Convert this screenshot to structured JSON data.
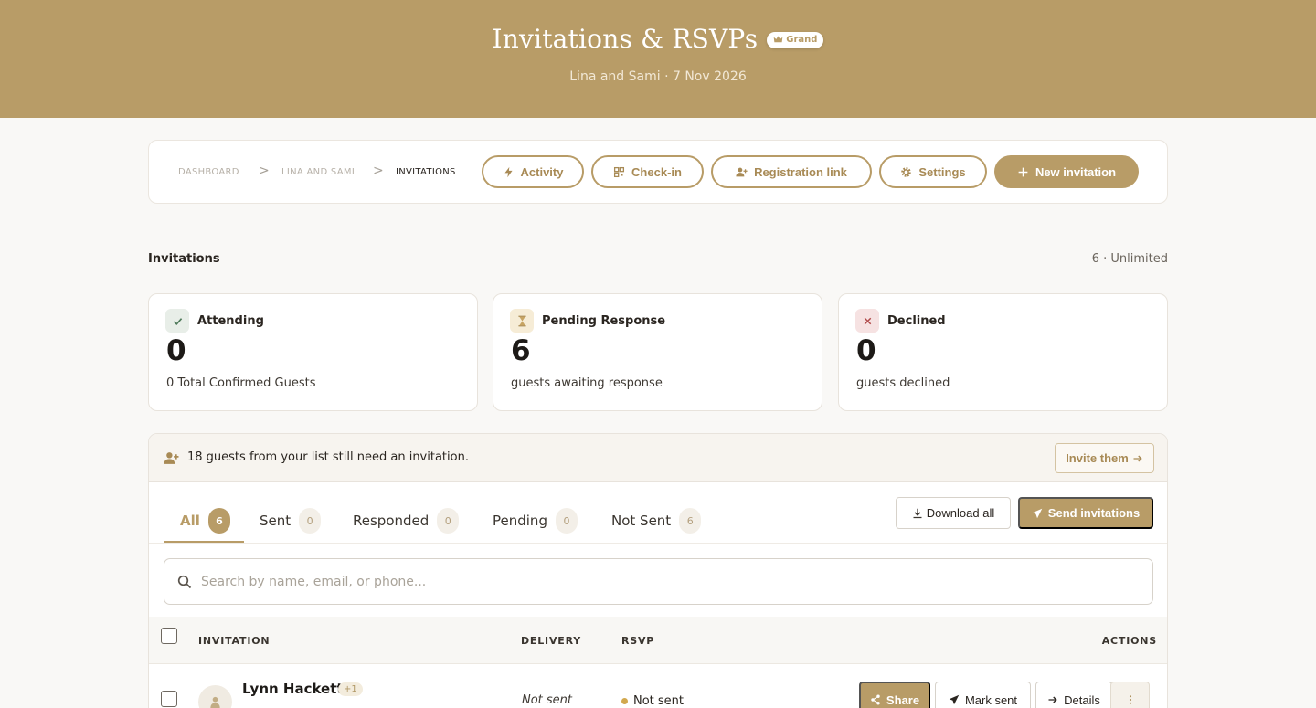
{
  "header": {
    "title": "Invitations & RSVPs",
    "tier": "Grand",
    "subtitle": "Lina and Sami · 7 Nov 2026"
  },
  "breadcrumb": {
    "items": [
      "DASHBOARD",
      "LINA AND SAMI",
      "INVITATIONS"
    ],
    "separator": ">"
  },
  "toolbar": {
    "activity": "Activity",
    "checkin": "Check-in",
    "registration_link": "Registration link",
    "settings": "Settings",
    "new_invitation": "New invitation"
  },
  "section": {
    "title": "Invitations",
    "meta": "6 · Unlimited"
  },
  "stats": [
    {
      "label": "Attending",
      "value": "0",
      "desc": "0 Total Confirmed Guests",
      "icon": "check-icon",
      "color": "#e8eee8"
    },
    {
      "label": "Pending Response",
      "value": "6",
      "desc": "guests awaiting response",
      "icon": "hourglass-icon",
      "color": "#f6ecd6"
    },
    {
      "label": "Declined",
      "value": "0",
      "desc": "guests declined",
      "icon": "x-icon",
      "color": "#f6e2e2"
    }
  ],
  "banner": {
    "text": "18 guests from your list still need an invitation.",
    "button": "Invite them"
  },
  "tabs": [
    {
      "label": "All",
      "count": "6"
    },
    {
      "label": "Sent",
      "count": "0"
    },
    {
      "label": "Responded",
      "count": "0"
    },
    {
      "label": "Pending",
      "count": "0"
    },
    {
      "label": "Not Sent",
      "count": "6"
    }
  ],
  "actions": {
    "download_all": "Download all",
    "send_invitations": "Send invitations"
  },
  "search": {
    "placeholder": "Search by name, email, or phone...",
    "value": ""
  },
  "table": {
    "columns": [
      "INVITATION",
      "DELIVERY",
      "RSVP",
      "ACTIONS"
    ],
    "rows": [
      {
        "name": "Lynn Hackett",
        "plus": "+1",
        "delivery": "Not sent",
        "rsvp": "Not sent",
        "share": "Share",
        "mark_sent": "Mark sent",
        "details": "Details"
      }
    ]
  },
  "colors": {
    "accent": "#b89c67",
    "hero_bg": "#b89c67",
    "page_bg": "#f9f8f6",
    "pending_dot": "#d2a84e"
  }
}
